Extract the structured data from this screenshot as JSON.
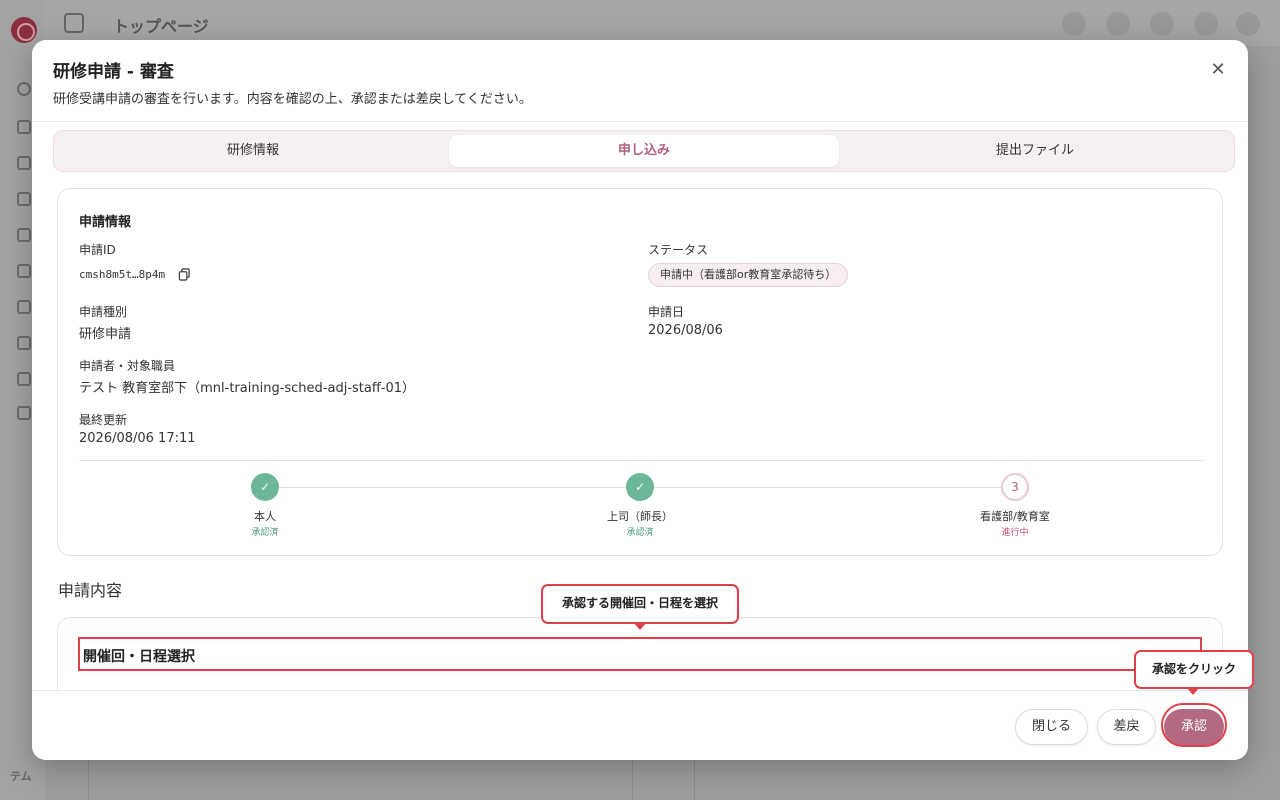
{
  "background": {
    "header_title": "トップページ",
    "sidebar_bottom": "テム"
  },
  "modal": {
    "title": "研修申請 - 審査",
    "description": "研修受講申請の審査を行います。内容を確認の上、承認または差戻してください。",
    "close_icon": "close-icon"
  },
  "tabs": [
    {
      "label": "研修情報",
      "active": false
    },
    {
      "label": "申し込み",
      "active": true
    },
    {
      "label": "提出ファイル",
      "active": false
    }
  ],
  "application_info": {
    "title": "申請情報",
    "id_label": "申請ID",
    "id_value": "cmsh8m5t…8p4m",
    "status_label": "ステータス",
    "status_value": "申請中（看護部or教育室承認待ち）",
    "type_label": "申請種別",
    "type_value": "研修申請",
    "date_label": "申請日",
    "date_value": "2026/08/06",
    "applicant_label": "申請者・対象職員",
    "applicant_value": "テスト 教育室部下（mnl-training-sched-adj-staff-01）",
    "updated_label": "最終更新",
    "updated_value": "2026/08/06 17:11"
  },
  "steps": [
    {
      "name": "本人",
      "status": "承認済",
      "state": "done",
      "icon": "check-icon"
    },
    {
      "name": "上司（師長）",
      "status": "承認済",
      "state": "done",
      "icon": "check-icon"
    },
    {
      "name": "看護部/教育室",
      "status": "進行中",
      "state": "current",
      "number": "3"
    }
  ],
  "content": {
    "section_title": "申請内容",
    "heading": "開催回・日程選択"
  },
  "footer": {
    "close_label": "閉じる",
    "return_label": "差戻",
    "approve_label": "承認"
  },
  "tooltips": {
    "select_schedule": "承認する開催回・日程を選択",
    "click_approve": "承認をクリック"
  },
  "colors": {
    "accent": "#b36a80",
    "highlight": "#e0404a",
    "done": "#6cb79a"
  }
}
